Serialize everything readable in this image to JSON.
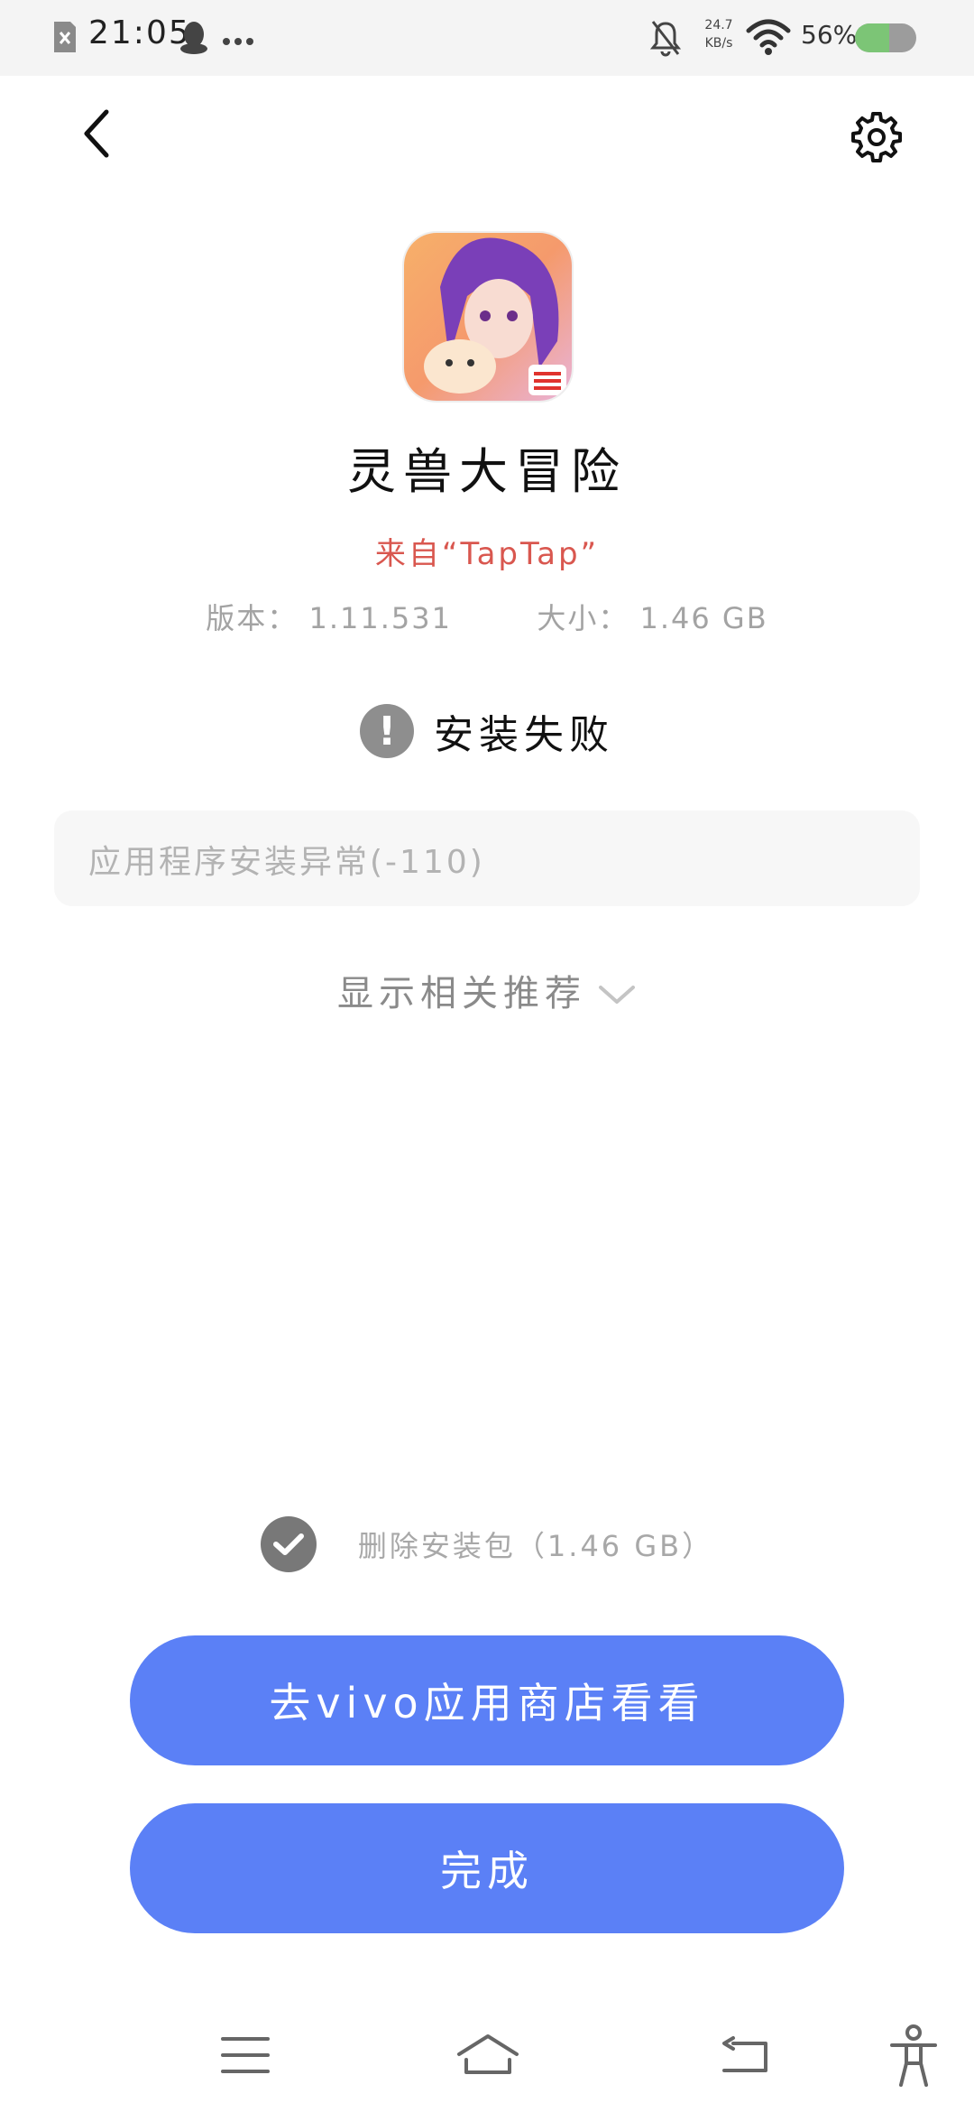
{
  "status_bar": {
    "time": "21:05",
    "network_speed_value": "24.7",
    "network_speed_unit": "KB/s",
    "battery_percent_text": "56%",
    "battery_level": 0.56,
    "icons": [
      "sim-off-icon",
      "qq-icon",
      "more-dots-icon",
      "bell-mute-icon",
      "wifi-icon",
      "battery-icon"
    ]
  },
  "header": {
    "back_icon": "chevron-left-icon",
    "settings_icon": "gear-icon"
  },
  "app": {
    "name": "灵兽大冒险",
    "source": "来自“TapTap”",
    "version": "版本： 1.11.531",
    "size": "大小： 1.46 GB"
  },
  "result": {
    "status_symbol": "!",
    "status_text": "安装失败",
    "error_message": "应用程序安装异常(-110)"
  },
  "recommend": {
    "label": "显示相关推荐"
  },
  "delete_package": {
    "checked": true,
    "label": "删除安装包（1.46 GB）"
  },
  "buttons": {
    "store": "去vivo应用商店看看",
    "done": "完成"
  },
  "nav_bar": {
    "icons": [
      "menu-icon",
      "home-icon",
      "back-nav-icon",
      "accessibility-icon"
    ]
  },
  "colors": {
    "primary_button": "#5b80f6",
    "source_text": "#d9574f",
    "battery_fill": "#7cc576"
  }
}
